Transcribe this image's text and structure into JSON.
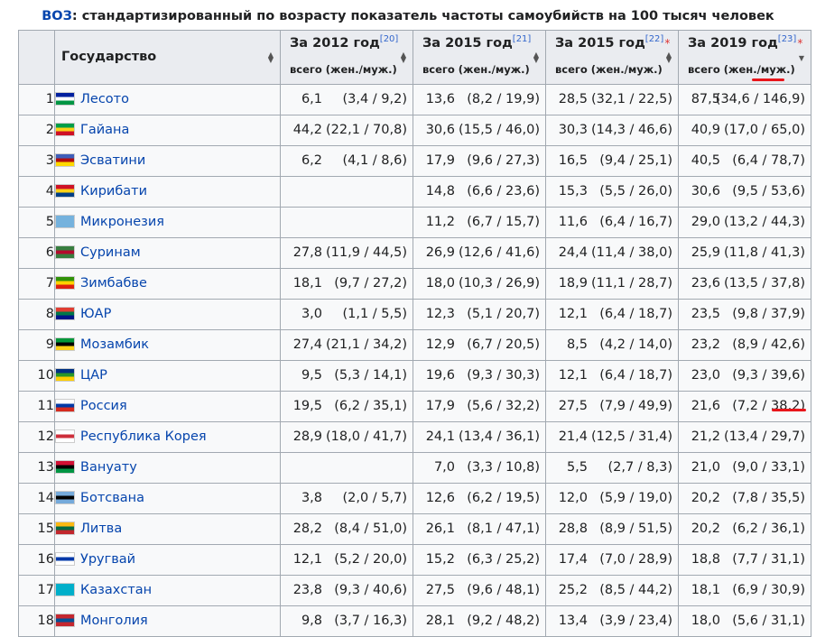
{
  "caption": {
    "link": "ВОЗ",
    "text": ": стандартизированный по возрасту показатель частоты самоубийств на 100 тысяч человек"
  },
  "header": {
    "state": "Государство",
    "columns": [
      {
        "year": "За 2012 год",
        "ref": "[20]",
        "star": "",
        "sub": "всего (жен./муж.)"
      },
      {
        "year": "За 2015 год",
        "ref": "[21]",
        "star": "",
        "sub": "всего (жен./муж.)"
      },
      {
        "year": "За 2015 год",
        "ref": "[22]",
        "star": "*",
        "sub": "всего (жен./муж.)"
      },
      {
        "year": "За 2019 год",
        "ref": "[23]",
        "star": "*",
        "sub": "всего (жен./муж.)"
      }
    ]
  },
  "rows": [
    {
      "n": "1",
      "country": "Лесото",
      "flag": [
        "#00209f",
        "#ffffff",
        "#009543"
      ],
      "v": [
        [
          "6,1",
          "(3,4 / 9,2)"
        ],
        [
          "13,6",
          "(8,2 / 19,9)"
        ],
        [
          "28,5",
          "(32,1 / 22,5)"
        ],
        [
          "87,5",
          "(34,6 / 146,9)"
        ]
      ]
    },
    {
      "n": "2",
      "country": "Гайана",
      "flag": [
        "#009e49",
        "#fcd116",
        "#ce1126"
      ],
      "v": [
        [
          "44,2",
          "(22,1 / 70,8)"
        ],
        [
          "30,6",
          "(15,5 / 46,0)"
        ],
        [
          "30,3",
          "(14,3 / 46,6)"
        ],
        [
          "40,9",
          "(17,0 / 65,0)"
        ]
      ]
    },
    {
      "n": "3",
      "country": "Эсватини",
      "flag": [
        "#3e5eb9",
        "#b10c0c",
        "#ffd900"
      ],
      "v": [
        [
          "6,2",
          "(4,1 / 8,6)"
        ],
        [
          "17,9",
          "(9,6 / 27,3)"
        ],
        [
          "16,5",
          "(9,4 / 25,1)"
        ],
        [
          "40,5",
          "(6,4 / 78,7)"
        ]
      ]
    },
    {
      "n": "4",
      "country": "Кирибати",
      "flag": [
        "#ce1126",
        "#fcd116",
        "#003f87"
      ],
      "v": [
        [
          "",
          ""
        ],
        [
          "14,8",
          "(6,6 / 23,6)"
        ],
        [
          "15,3",
          "(5,5 / 26,0)"
        ],
        [
          "30,6",
          "(9,5 / 53,6)"
        ]
      ]
    },
    {
      "n": "5",
      "country": "Микронезия",
      "flag": [
        "#75b2dd",
        "#75b2dd",
        "#75b2dd"
      ],
      "v": [
        [
          "",
          ""
        ],
        [
          "11,2",
          "(6,7 / 15,7)"
        ],
        [
          "11,6",
          "(6,4 / 16,7)"
        ],
        [
          "29,0",
          "(13,2 / 44,3)"
        ]
      ]
    },
    {
      "n": "6",
      "country": "Суринам",
      "flag": [
        "#377e3f",
        "#b40a2d",
        "#377e3f"
      ],
      "v": [
        [
          "27,8",
          "(11,9 / 44,5)"
        ],
        [
          "26,9",
          "(12,6 / 41,6)"
        ],
        [
          "24,4",
          "(11,4 / 38,0)"
        ],
        [
          "25,9",
          "(11,8 / 41,3)"
        ]
      ]
    },
    {
      "n": "7",
      "country": "Зимбабве",
      "flag": [
        "#319208",
        "#ffd200",
        "#de2010"
      ],
      "v": [
        [
          "18,1",
          "(9,7 / 27,2)"
        ],
        [
          "18,0",
          "(10,3 / 26,9)"
        ],
        [
          "18,9",
          "(11,1 / 28,7)"
        ],
        [
          "23,6",
          "(13,5 / 37,8)"
        ]
      ]
    },
    {
      "n": "8",
      "country": "ЮАР",
      "flag": [
        "#e03c31",
        "#007749",
        "#001489"
      ],
      "v": [
        [
          "3,0",
          "(1,1 / 5,5)"
        ],
        [
          "12,3",
          "(5,1 / 20,7)"
        ],
        [
          "12,1",
          "(6,4 / 18,7)"
        ],
        [
          "23,5",
          "(9,8 / 37,9)"
        ]
      ]
    },
    {
      "n": "9",
      "country": "Мозамбик",
      "flag": [
        "#009739",
        "#000000",
        "#fcd116"
      ],
      "v": [
        [
          "27,4",
          "(21,1 / 34,2)"
        ],
        [
          "12,9",
          "(6,7 / 20,5)"
        ],
        [
          "8,5",
          "(4,2 / 14,0)"
        ],
        [
          "23,2",
          "(8,9 / 42,6)"
        ]
      ]
    },
    {
      "n": "10",
      "country": "ЦАР",
      "flag": [
        "#003082",
        "#289728",
        "#ffce00"
      ],
      "v": [
        [
          "9,5",
          "(5,3 / 14,1)"
        ],
        [
          "19,6",
          "(9,3 / 30,3)"
        ],
        [
          "12,1",
          "(6,4 / 18,7)"
        ],
        [
          "23,0",
          "(9,3 / 39,6)"
        ]
      ]
    },
    {
      "n": "11",
      "country": "Россия",
      "flag": [
        "#ffffff",
        "#0039a6",
        "#d52b1e"
      ],
      "v": [
        [
          "19,5",
          "(6,2 / 35,1)"
        ],
        [
          "17,9",
          "(5,6 / 32,2)"
        ],
        [
          "27,5",
          "(7,9 / 49,9)"
        ],
        [
          "21,6",
          "(7,2 / 38,2)"
        ]
      ]
    },
    {
      "n": "12",
      "country": "Республика Корея",
      "flag": [
        "#ffffff",
        "#cd2e3a",
        "#ffffff"
      ],
      "v": [
        [
          "28,9",
          "(18,0 / 41,7)"
        ],
        [
          "24,1",
          "(13,4 / 36,1)"
        ],
        [
          "21,4",
          "(12,5 / 31,4)"
        ],
        [
          "21,2",
          "(13,4 / 29,7)"
        ]
      ]
    },
    {
      "n": "13",
      "country": "Вануату",
      "flag": [
        "#d21034",
        "#000000",
        "#009543"
      ],
      "v": [
        [
          "",
          ""
        ],
        [
          "7,0",
          "(3,3 / 10,8)"
        ],
        [
          "5,5",
          "(2,7 / 8,3)"
        ],
        [
          "21,0",
          "(9,0 / 33,1)"
        ]
      ]
    },
    {
      "n": "14",
      "country": "Ботсвана",
      "flag": [
        "#75aadb",
        "#000000",
        "#75aadb"
      ],
      "v": [
        [
          "3,8",
          "(2,0 / 5,7)"
        ],
        [
          "12,6",
          "(6,2 / 19,5)"
        ],
        [
          "12,0",
          "(5,9 / 19,0)"
        ],
        [
          "20,2",
          "(7,8 / 35,5)"
        ]
      ]
    },
    {
      "n": "15",
      "country": "Литва",
      "flag": [
        "#fdb913",
        "#006a44",
        "#c1272d"
      ],
      "v": [
        [
          "28,2",
          "(8,4 / 51,0)"
        ],
        [
          "26,1",
          "(8,1 / 47,1)"
        ],
        [
          "28,8",
          "(8,9 / 51,5)"
        ],
        [
          "20,2",
          "(6,2 / 36,1)"
        ]
      ]
    },
    {
      "n": "16",
      "country": "Уругвай",
      "flag": [
        "#ffffff",
        "#0038a8",
        "#ffffff"
      ],
      "v": [
        [
          "12,1",
          "(5,2 / 20,0)"
        ],
        [
          "15,2",
          "(6,3 / 25,2)"
        ],
        [
          "17,4",
          "(7,0 / 28,9)"
        ],
        [
          "18,8",
          "(7,7 / 31,1)"
        ]
      ]
    },
    {
      "n": "17",
      "country": "Казахстан",
      "flag": [
        "#00afca",
        "#00afca",
        "#00afca"
      ],
      "v": [
        [
          "23,8",
          "(9,3 / 40,6)"
        ],
        [
          "27,5",
          "(9,6 / 48,1)"
        ],
        [
          "25,2",
          "(8,5 / 44,2)"
        ],
        [
          "18,1",
          "(6,9 / 30,9)"
        ]
      ]
    },
    {
      "n": "18",
      "country": "Монголия",
      "flag": [
        "#c4272f",
        "#015197",
        "#c4272f"
      ],
      "v": [
        [
          "9,8",
          "(3,7 / 16,3)"
        ],
        [
          "28,1",
          "(9,2 / 48,2)"
        ],
        [
          "13,4",
          "(3,9 / 23,4)"
        ],
        [
          "18,0",
          "(5,6 / 31,1)"
        ]
      ]
    }
  ]
}
